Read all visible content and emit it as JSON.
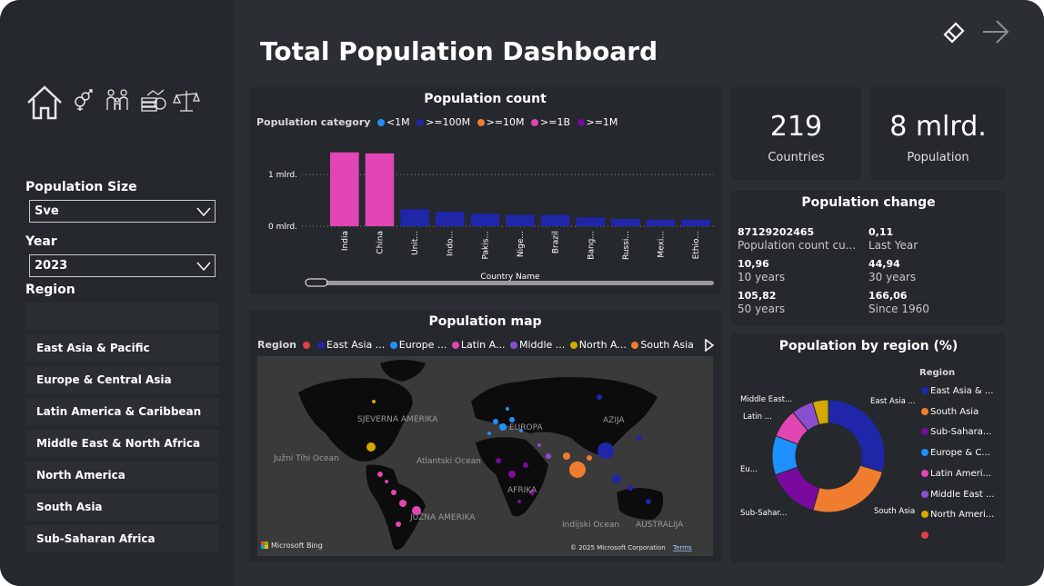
{
  "title": "Total Population Dashboard",
  "nav_icons": [
    "home-icon",
    "gender-icon",
    "family-icon",
    "money-icon",
    "balance-icon"
  ],
  "filters": {
    "population_size": {
      "label": "Population Size",
      "value": "Sve"
    },
    "year": {
      "label": "Year",
      "value": "2023"
    },
    "region": {
      "label": "Region",
      "search_value": "",
      "items": [
        "East Asia & Pacific",
        "Europe & Central Asia",
        "Latin America & Caribbean",
        "Middle East & North Africa",
        "North America",
        "South Asia",
        "Sub-Saharan Africa"
      ]
    }
  },
  "population_count": {
    "title": "Population count",
    "legend_title": "Population category",
    "legend": [
      {
        "label": "<1M",
        "color": "#1e90ff"
      },
      {
        "label": ">=100M",
        "color": "#1f26a8"
      },
      {
        "label": ">=10M",
        "color": "#f07c30"
      },
      {
        "label": ">=1B",
        "color": "#e146b4"
      },
      {
        "label": ">=1M",
        "color": "#7a0a9e"
      }
    ],
    "y_ticks": [
      "1 mlrd.",
      "0 mlrd."
    ],
    "x_title": "Country Name"
  },
  "chart_data": {
    "type": "bar",
    "categories": [
      "India",
      "China",
      "Unit...",
      "Indo...",
      "Pakis...",
      "Nige...",
      "Brazil",
      "Bang...",
      "Russi...",
      "Mexi...",
      "Ethio..."
    ],
    "values": [
      1.43,
      1.41,
      0.33,
      0.28,
      0.24,
      0.22,
      0.22,
      0.17,
      0.14,
      0.13,
      0.13
    ],
    "series_colors": [
      "#e146b4",
      "#e146b4",
      "#1f26a8",
      "#1f26a8",
      "#1f26a8",
      "#1f26a8",
      "#1f26a8",
      "#1f26a8",
      "#1f26a8",
      "#1f26a8",
      "#1f26a8"
    ],
    "ylabel": "",
    "xlabel": "Country Name",
    "ylim": [
      0,
      1.6
    ],
    "units": "mlrd."
  },
  "kpis": [
    {
      "value": "219",
      "label": "Countries"
    },
    {
      "value": "8 mlrd.",
      "label": "Population"
    }
  ],
  "population_change": {
    "title": "Population change",
    "items": [
      {
        "value": "87129202465",
        "label": "Population count cu..."
      },
      {
        "value": "0,11",
        "label": "Last Year"
      },
      {
        "value": "10,96",
        "label": "10 years"
      },
      {
        "value": "44,94",
        "label": "30 years"
      },
      {
        "value": "105,82",
        "label": "50 years"
      },
      {
        "value": "166,06",
        "label": "Since 1960"
      }
    ]
  },
  "population_map": {
    "title": "Population map",
    "legend_title": "Region",
    "legend": [
      {
        "label": "",
        "color": "#e0404a"
      },
      {
        "label": "East Asia ...",
        "color": "#1f26a8"
      },
      {
        "label": "Europe ...",
        "color": "#1e90ff"
      },
      {
        "label": "Latin A...",
        "color": "#e146b4"
      },
      {
        "label": "Middle ...",
        "color": "#8a4fd0"
      },
      {
        "label": "North A...",
        "color": "#d4a800"
      },
      {
        "label": "South Asia",
        "color": "#f07c30"
      }
    ],
    "labels": [
      "SJEVERNA AMERIKA",
      "EUROPA",
      "AZIJA",
      "Južni Tihi Ocean",
      "Atlantski Ocean",
      "AFRIKA",
      "JUŽNA AMERIKA",
      "Indijski Ocean",
      "AUSTRALIJA"
    ],
    "attribution": "Microsoft Bing",
    "copyright": "© 2025 Microsoft Corporation",
    "terms": "Terms"
  },
  "population_by_region": {
    "title": "Population by region (%)",
    "legend_title": "Region",
    "legend": [
      {
        "label": "East Asia & ...",
        "color": "#1f26a8"
      },
      {
        "label": "South Asia",
        "color": "#f07c30"
      },
      {
        "label": "Sub-Sahara...",
        "color": "#7a0a9e"
      },
      {
        "label": "Europe & C...",
        "color": "#1e90ff"
      },
      {
        "label": "Latin Ameri...",
        "color": "#e146b4"
      },
      {
        "label": "Middle East ...",
        "color": "#8a4fd0"
      },
      {
        "label": "North Ameri...",
        "color": "#d4a800"
      },
      {
        "label": "",
        "color": "#e0404a"
      }
    ],
    "donut_labels": [
      "East Asia ...",
      "South Asia",
      "Sub-Sahar...",
      "Eu...",
      "Latin ...",
      "Middle East..."
    ],
    "donut_data": {
      "type": "pie",
      "categories": [
        "East Asia & Pacific",
        "South Asia",
        "Sub-Saharan Africa",
        "Europe & Central Asia",
        "Latin America & Caribbean",
        "Middle East & North Africa",
        "North America"
      ],
      "values": [
        29.8,
        25.1,
        15.2,
        11.4,
        8.4,
        6.3,
        4.6
      ]
    }
  }
}
